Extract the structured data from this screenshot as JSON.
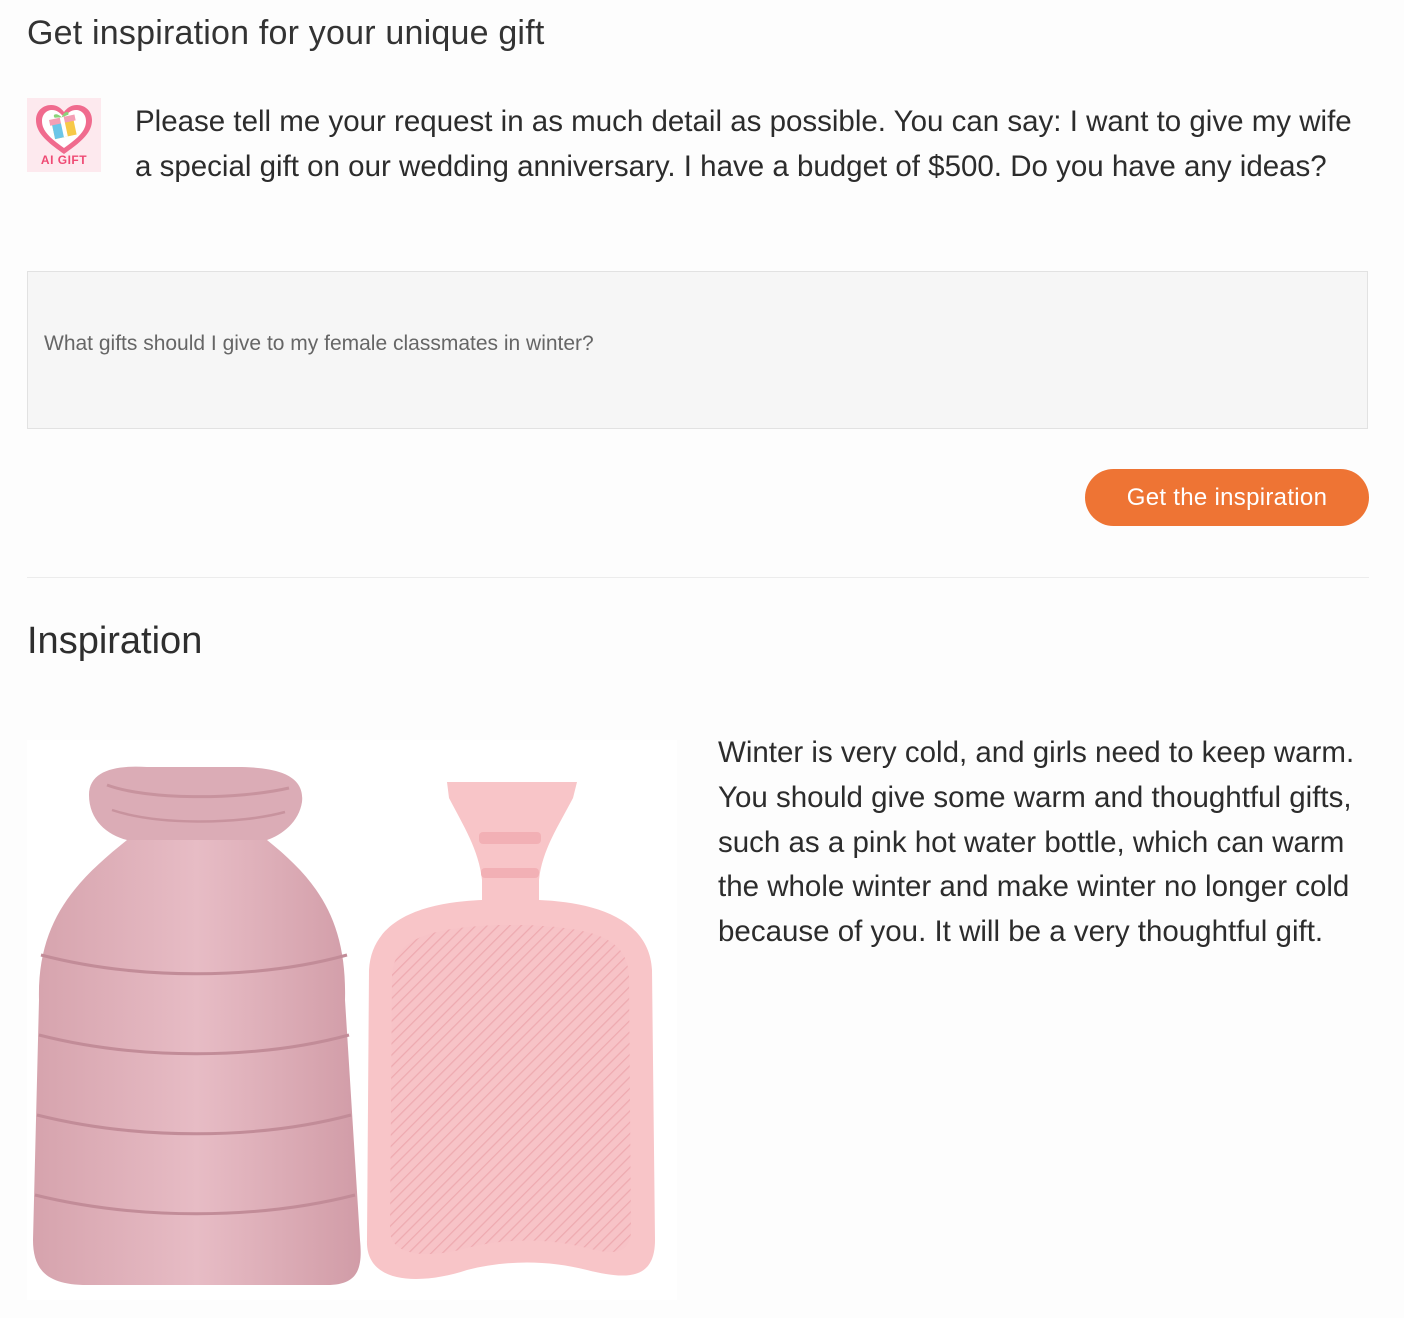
{
  "header": {
    "title": "Get inspiration for your unique gift"
  },
  "assistant": {
    "logo_label": "AI GIFT",
    "prompt": "Please tell me your request in as much detail as possible. You can say: I want to give my wife a special gift on our wedding anniversary. I have a budget of $500. Do you have any ideas?"
  },
  "request": {
    "value": "What gifts should I give to my female classmates in winter?",
    "placeholder": ""
  },
  "actions": {
    "submit_label": "Get the inspiration"
  },
  "colors": {
    "accent": "#ee7434",
    "logo_pink": "#ef4a74",
    "product_pink": "#f5bcc0",
    "plush_pink": "#dfb0ba"
  },
  "result": {
    "title": "Inspiration",
    "image_icon": "pink-hot-water-bottle-image",
    "text": "Winter is very cold, and girls need to keep warm. You should give some warm and thoughtful gifts, such as a pink hot water bottle, which can warm the whole winter and make winter no longer cold because of you. It will be a very thoughtful gift."
  }
}
